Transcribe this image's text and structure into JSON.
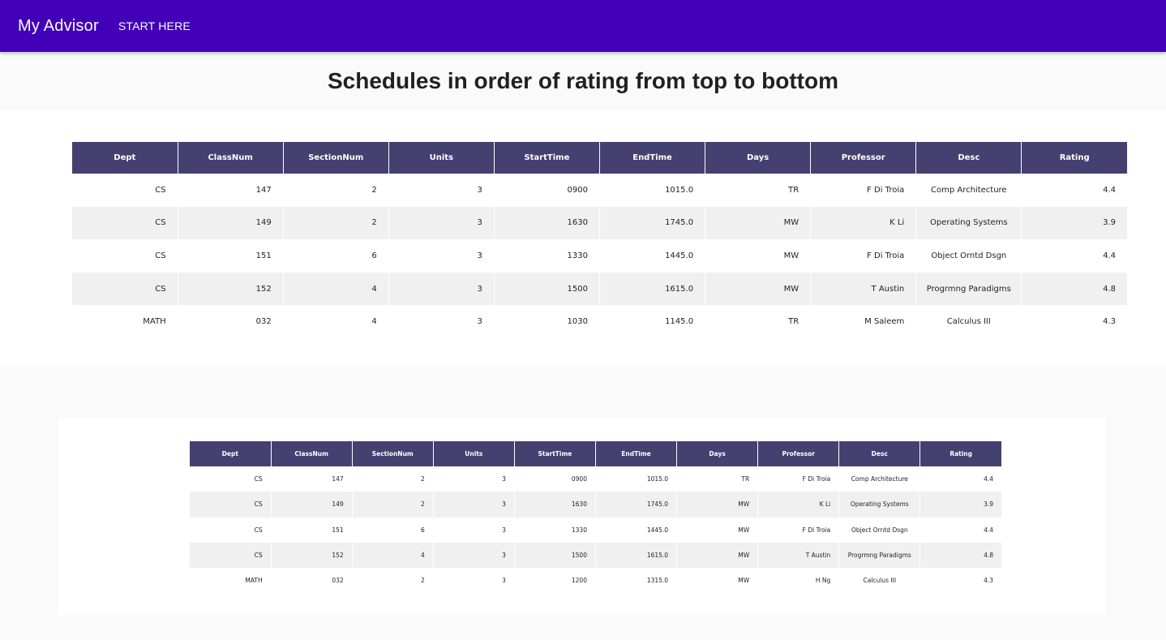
{
  "app": {
    "title": "My Advisor",
    "nav_start": "START HERE"
  },
  "page": {
    "title": "Schedules in order of rating from top to bottom"
  },
  "columns": [
    "Dept",
    "ClassNum",
    "SectionNum",
    "Units",
    "StartTime",
    "EndTime",
    "Days",
    "Professor",
    "Desc",
    "Rating"
  ],
  "schedules": [
    {
      "rows": [
        [
          "CS",
          "147",
          "2",
          "3",
          "0900",
          "1015.0",
          "TR",
          "F Di Troia",
          "Comp Architecture",
          "4.4"
        ],
        [
          "CS",
          "149",
          "2",
          "3",
          "1630",
          "1745.0",
          "MW",
          "K Li",
          "Operating Systems",
          "3.9"
        ],
        [
          "CS",
          "151",
          "6",
          "3",
          "1330",
          "1445.0",
          "MW",
          "F Di Troia",
          "Object Orntd Dsgn",
          "4.4"
        ],
        [
          "CS",
          "152",
          "4",
          "3",
          "1500",
          "1615.0",
          "MW",
          "T Austin",
          "Progrmng Paradigms",
          "4.8"
        ],
        [
          "MATH",
          "032",
          "4",
          "3",
          "1030",
          "1145.0",
          "TR",
          "M Saleem",
          "Calculus III",
          "4.3"
        ]
      ]
    },
    {
      "rows": [
        [
          "CS",
          "147",
          "2",
          "3",
          "0900",
          "1015.0",
          "TR",
          "F Di Troia",
          "Comp Architecture",
          "4.4"
        ],
        [
          "CS",
          "149",
          "2",
          "3",
          "1630",
          "1745.0",
          "MW",
          "K Li",
          "Operating Systems",
          "3.9"
        ],
        [
          "CS",
          "151",
          "6",
          "3",
          "1330",
          "1445.0",
          "MW",
          "F Di Troia",
          "Object Orntd Dsgn",
          "4.4"
        ],
        [
          "CS",
          "152",
          "4",
          "3",
          "1500",
          "1615.0",
          "MW",
          "T Austin",
          "Progrmng Paradigms",
          "4.8"
        ],
        [
          "MATH",
          "032",
          "2",
          "3",
          "1200",
          "1315.0",
          "MW",
          "H Ng",
          "Calculus III",
          "4.3"
        ]
      ]
    }
  ],
  "colors": {
    "appbar": "#4200b9",
    "table_header": "#44406f",
    "row_alt": "#f0f0f0"
  }
}
